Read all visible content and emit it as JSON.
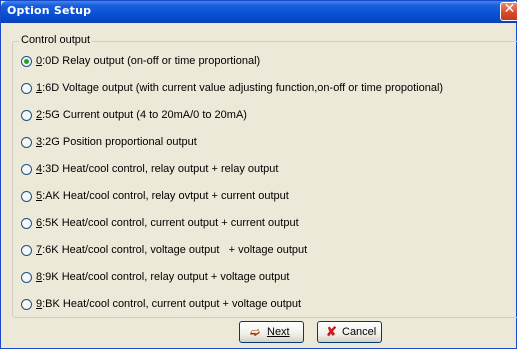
{
  "window": {
    "title": "Option Setup",
    "close_icon": "close-icon"
  },
  "group": {
    "legend": "Control output"
  },
  "options": [
    {
      "key": "0",
      "label": ":0D Relay output (on-off or time proportional)",
      "checked": true
    },
    {
      "key": "1",
      "label": ":6D Voltage output (with current value adjusting function,on-off or time propotional)",
      "checked": false
    },
    {
      "key": "2",
      "label": ":5G Current output (4 to 20mA/0 to 20mA)",
      "checked": false
    },
    {
      "key": "3",
      "label": ":2G Position proportional output",
      "checked": false
    },
    {
      "key": "4",
      "label": ":3D Heat/cool control, relay output + relay output",
      "checked": false
    },
    {
      "key": "5",
      "label": ":AK Heat/cool control, relay ovtput + current output",
      "checked": false
    },
    {
      "key": "6",
      "label": ":5K Heat/cool control, current output + current output",
      "checked": false
    },
    {
      "key": "7",
      "label": ":6K Heat/cool control, voltage output   + voltage output",
      "checked": false
    },
    {
      "key": "8",
      "label": ":9K Heat/cool control, relay output + voltage output",
      "checked": false
    },
    {
      "key": "9",
      "label": ":BK Heat/cool control, current output + voltage output",
      "checked": false
    }
  ],
  "buttons": {
    "next_label": "Next",
    "next_icon": "next-arrow-icon",
    "cancel_label": "Cancel",
    "cancel_icon": "cancel-x-icon"
  },
  "colors": {
    "titlebar": "#0a52d6",
    "dialog_bg": "#ece9d8",
    "radio_dot": "#21a121",
    "close_button": "#d8482a"
  }
}
